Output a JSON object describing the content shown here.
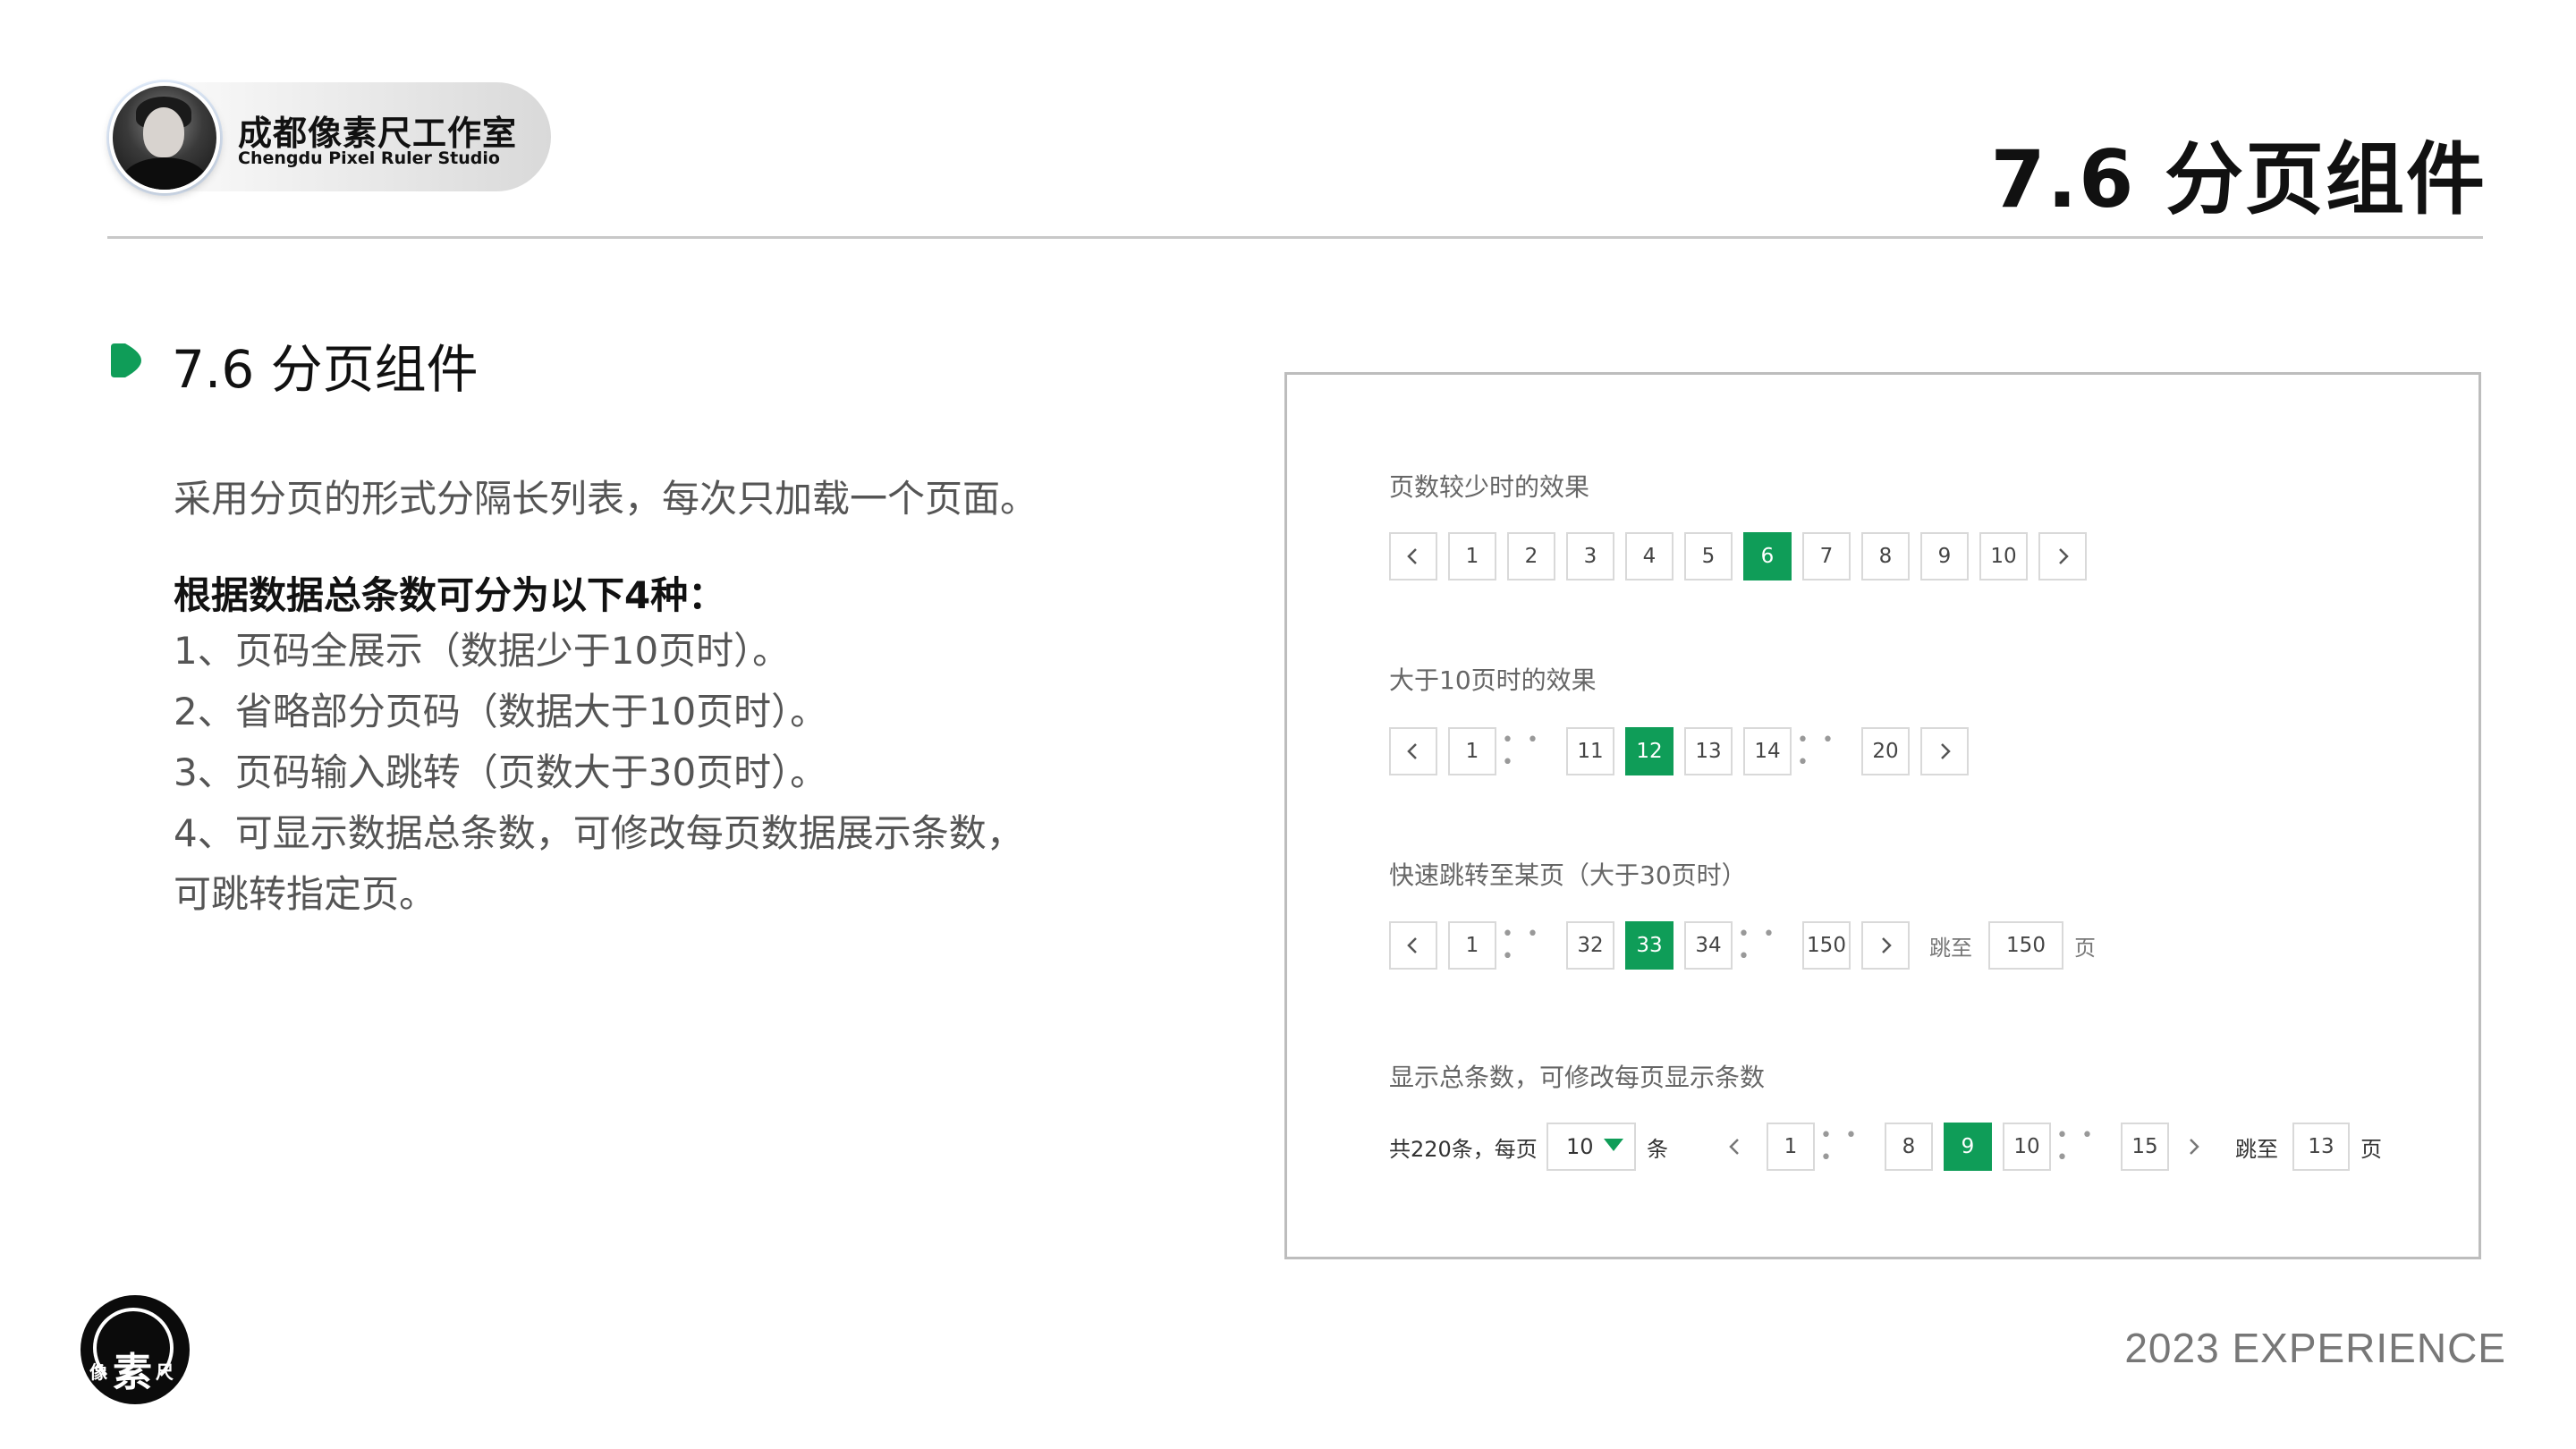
{
  "header": {
    "studio_name": "成都像素尺工作室",
    "studio_en": "Chengdu Pixel Ruler Studio",
    "title": "7.6 分页组件"
  },
  "section": {
    "title": "7.6 分页组件",
    "intro": "采用分页的形式分隔长列表，每次只加载一个页面。",
    "subhead": "根据数据总条数可分为以下4种：",
    "rules": [
      "1、页码全展示（数据少于10页时）。",
      "2、省略部分页码（数据大于10页时）。",
      "3、页码输入跳转（页数大于30页时）。",
      "4、可显示数据总条数，可修改每页数据展示条数，",
      "可跳转指定页。"
    ]
  },
  "demos": {
    "demo1": {
      "label": "页数较少时的效果",
      "pages": [
        "1",
        "2",
        "3",
        "4",
        "5",
        "6",
        "7",
        "8",
        "9",
        "10"
      ],
      "active": "6"
    },
    "demo2": {
      "label": "大于10页时的效果",
      "pages": [
        "1",
        "11",
        "12",
        "13",
        "14",
        "20"
      ],
      "active": "12",
      "ellipsis": "• • •"
    },
    "demo3": {
      "label": "快速跳转至某页（大于30页时）",
      "pages": [
        "1",
        "32",
        "33",
        "34",
        "150"
      ],
      "active": "33",
      "ellipsis": "• • •",
      "jump_label": "跳至",
      "jump_value": "150",
      "page_unit": "页"
    },
    "demo4": {
      "label": "显示总条数，可修改每页显示条数",
      "total_text": "共220条，每页",
      "per_page_value": "10",
      "per_page_unit": "条",
      "pages": [
        "1",
        "8",
        "9",
        "10",
        "15"
      ],
      "active": "9",
      "ellipsis": "• • •",
      "jump_label": "跳至",
      "jump_value": "13",
      "page_unit": "页"
    }
  },
  "footer": {
    "logo_small_left": "像",
    "logo_main": "素",
    "logo_small_right": "尺",
    "year_text": "2023  EXPERIENCE"
  },
  "colors": {
    "accent": "#0f9d58",
    "border": "#d9d9d9",
    "text": "#333333"
  }
}
